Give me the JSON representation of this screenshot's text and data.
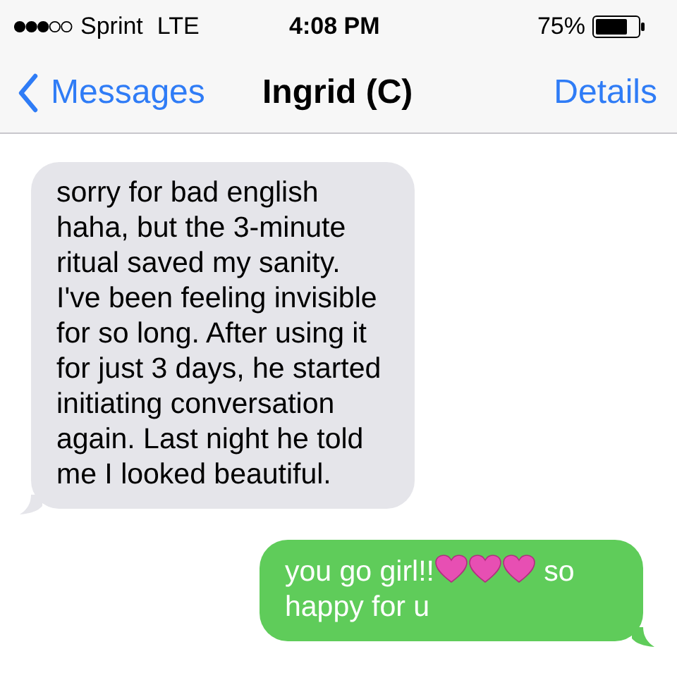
{
  "status_bar": {
    "carrier": "Sprint",
    "network": "LTE",
    "time": "4:08 PM",
    "battery": "75%"
  },
  "nav_bar": {
    "back": "Messages",
    "title": "Ingrid (C)",
    "action": "Details"
  },
  "messages": [
    {
      "kind": "received",
      "parts": [
        {
          "kind": "text",
          "text": "sorry for bad english haha, but the 3-minute ritual saved my sanity. I've been feeling invisible for so long. After using it for just 3 days, he started initiating conversation again. Last night he told me I looked beautiful."
        }
      ]
    },
    {
      "kind": "sent",
      "parts": [
        {
          "kind": "text",
          "text": "you go girl!!"
        },
        {
          "kind": "heart"
        },
        {
          "kind": "heart"
        },
        {
          "kind": "heart"
        },
        {
          "kind": "text",
          "text": " so happy for u"
        }
      ]
    }
  ]
}
